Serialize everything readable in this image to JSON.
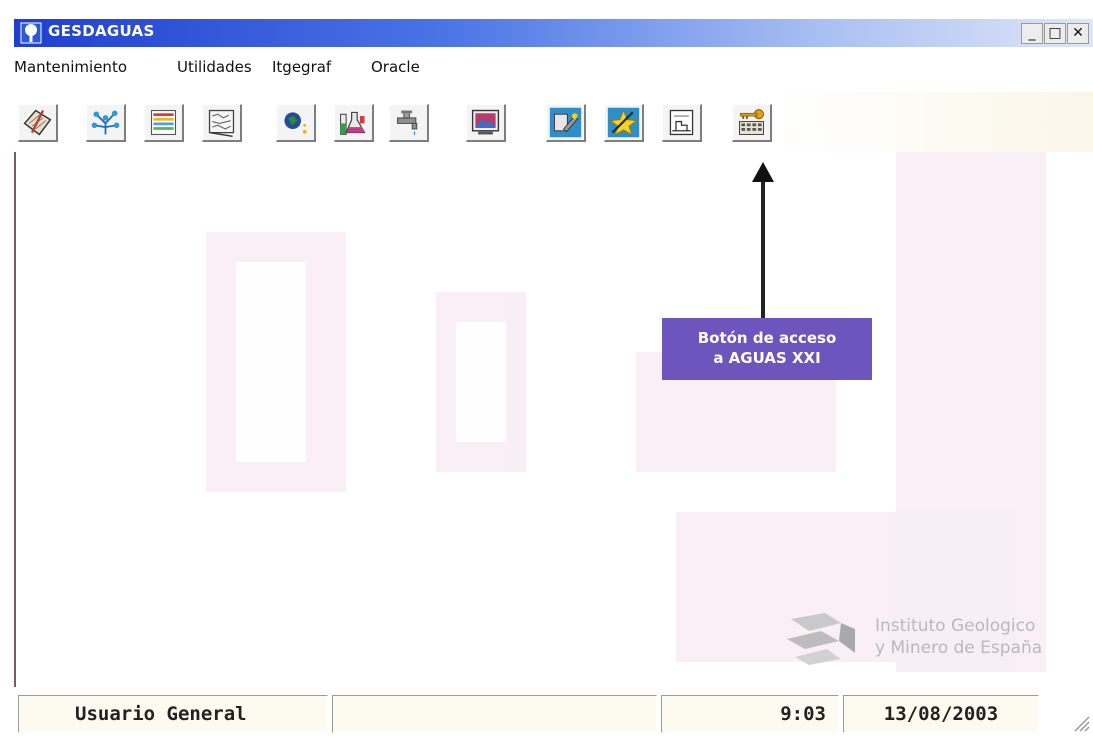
{
  "window": {
    "title": "GESDAGUAS",
    "icon": "tree-icon",
    "controls": {
      "minimize": "_",
      "maximize": "□",
      "close": "✕"
    }
  },
  "menu": [
    "Mantenimiento",
    "Utilidades",
    "Itgegraf",
    "Oracle"
  ],
  "toolbar": {
    "buttons": [
      {
        "icon": "notebook-pencil-icon"
      },
      {
        "icon": "network-tree-icon"
      },
      {
        "icon": "chart-grid-icon"
      },
      {
        "icon": "map-document-icon"
      },
      {
        "icon": "globe-search-icon"
      },
      {
        "icon": "lab-flask-icon"
      },
      {
        "icon": "water-tap-icon"
      },
      {
        "icon": "monitor-image-icon"
      },
      {
        "icon": "tools-wrench-icon"
      },
      {
        "icon": "lightning-star-icon"
      },
      {
        "icon": "well-log-icon"
      },
      {
        "icon": "aguas-xxi-key-icon"
      }
    ]
  },
  "annotation": {
    "line1": "Botón de acceso",
    "line2": "a AGUAS XXI",
    "color": "#6d55bd"
  },
  "logo": {
    "line1": "Instituto Geologico",
    "line2": "y Minero de España"
  },
  "status": {
    "user": "Usuario General",
    "message": "",
    "time": "9:03",
    "date": "13/08/2003"
  }
}
